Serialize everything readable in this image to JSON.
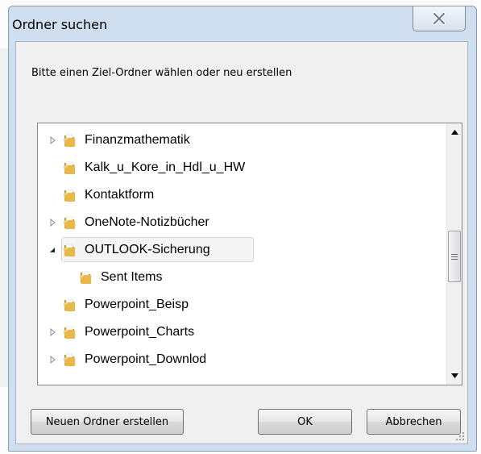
{
  "dialog": {
    "title": "Ordner suchen",
    "instruction": "Bitte einen Ziel-Ordner wählen oder neu erstellen",
    "close_icon": "close-icon"
  },
  "tree": {
    "items": [
      {
        "label": "Finanzmathematik",
        "expander": "collapsed",
        "level": 0,
        "selected": false
      },
      {
        "label": "Kalk_u_Kore_in_Hdl_u_HW",
        "expander": "none",
        "level": 0,
        "selected": false
      },
      {
        "label": "Kontaktform",
        "expander": "none",
        "level": 0,
        "selected": false
      },
      {
        "label": "OneNote-Notizbücher",
        "expander": "collapsed",
        "level": 0,
        "selected": false
      },
      {
        "label": "OUTLOOK-Sicherung",
        "expander": "expanded",
        "level": 0,
        "selected": true
      },
      {
        "label": "Sent Items",
        "expander": "none",
        "level": 1,
        "selected": false
      },
      {
        "label": "Powerpoint_Beisp",
        "expander": "none",
        "level": 0,
        "selected": false
      },
      {
        "label": "Powerpoint_Charts",
        "expander": "collapsed",
        "level": 0,
        "selected": false
      },
      {
        "label": "Powerpoint_Downlod",
        "expander": "collapsed",
        "level": 0,
        "selected": false
      }
    ],
    "scroll_position": 0.55
  },
  "buttons": {
    "new_folder": "Neuen Ordner erstellen",
    "ok": "OK",
    "cancel": "Abbrechen"
  },
  "colors": {
    "folder": "#e8b84a",
    "folder_dark": "#c98d1e",
    "frame": "#cfdff0"
  }
}
